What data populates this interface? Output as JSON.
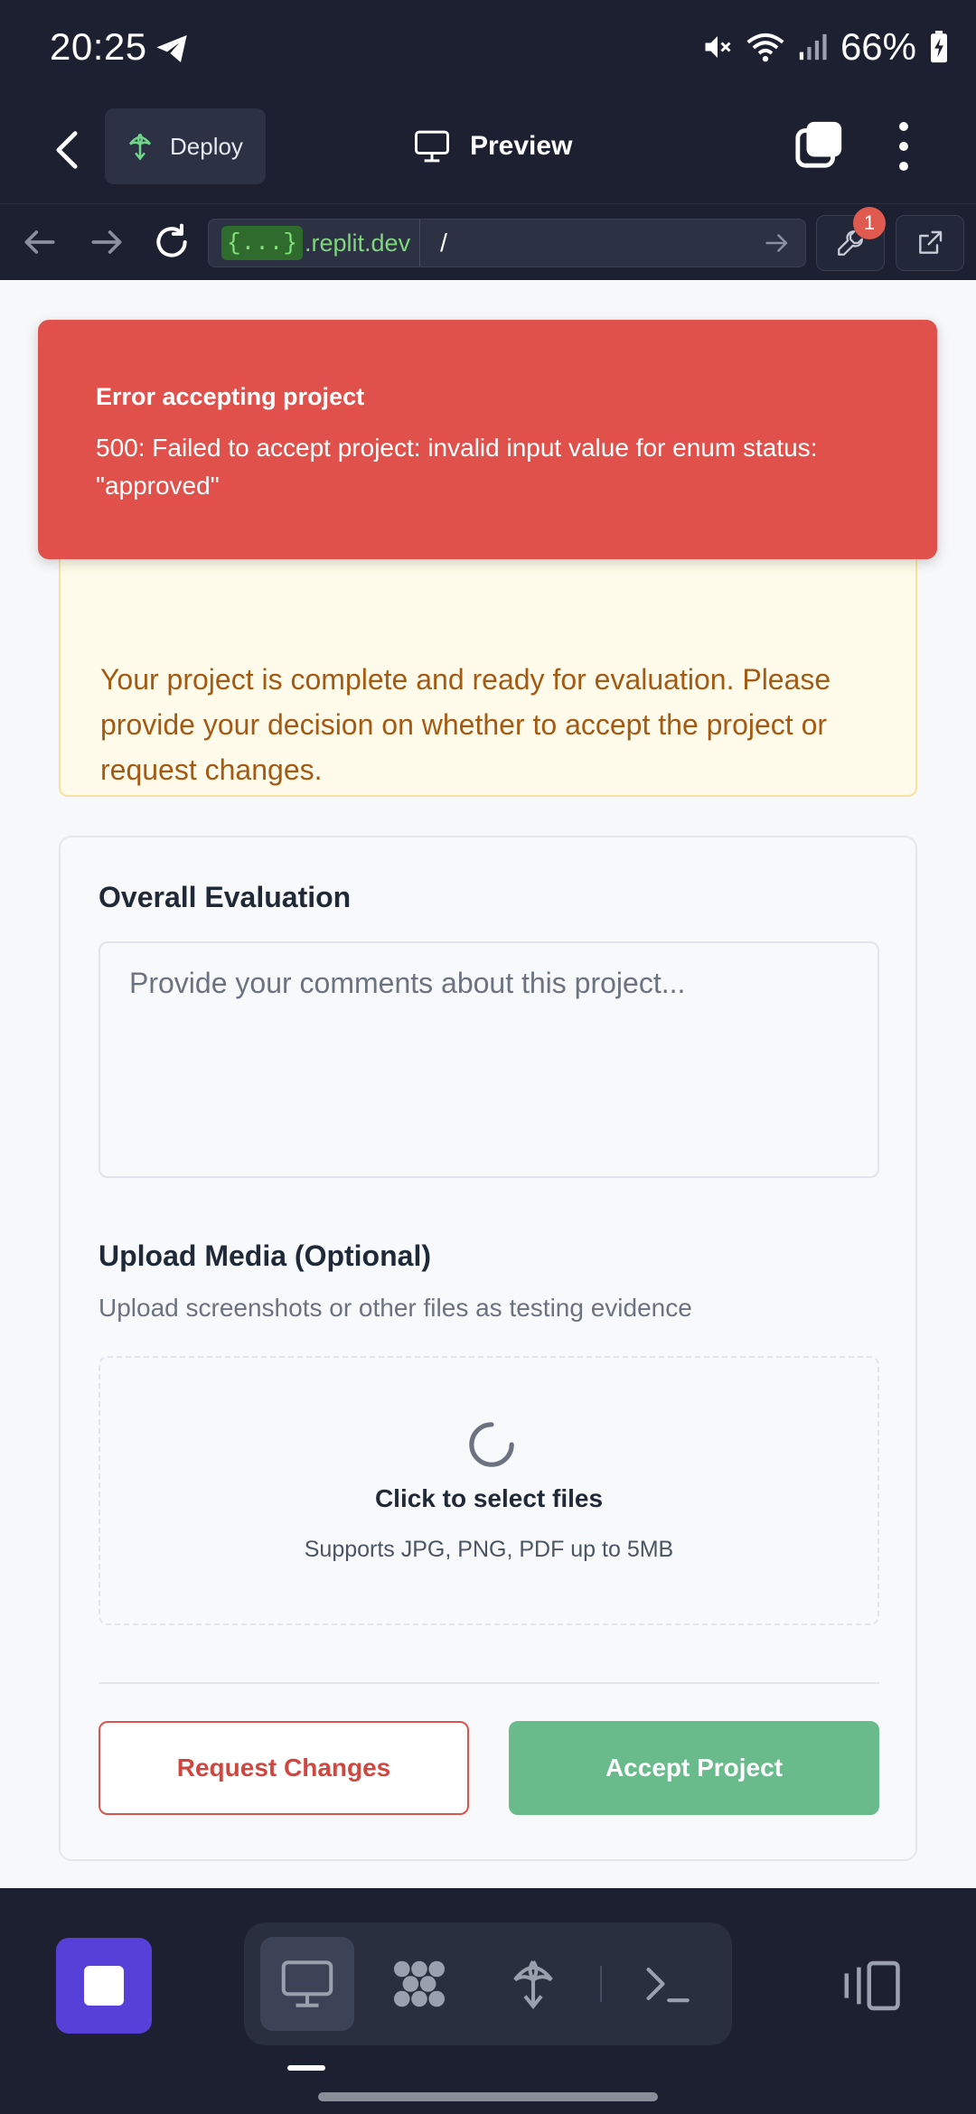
{
  "status_bar": {
    "time": "20:25",
    "battery": "66%",
    "icons": [
      "telegram-icon",
      "mute-icon",
      "wifi-icon",
      "signal-icon",
      "battery-charging-icon"
    ]
  },
  "app_bar": {
    "deploy_label": "Deploy",
    "preview_label": "Preview"
  },
  "url_bar": {
    "host_prefix": "{...}",
    "host_domain": ".replit.dev",
    "path": "/",
    "badge_count": "1"
  },
  "toast": {
    "title": "Error accepting project",
    "message": "500: Failed to accept project: invalid input value for enum status: \"approved\""
  },
  "notice": {
    "text": "Your project is complete and ready for evaluation. Please provide your decision on whether to accept the project or request changes."
  },
  "evaluation": {
    "title": "Overall Evaluation",
    "comment_placeholder": "Provide your comments about this project..."
  },
  "upload": {
    "title": "Upload Media (Optional)",
    "description": "Upload screenshots or other files as testing evidence",
    "dropzone_title": "Click to select files",
    "dropzone_subtitle": "Supports JPG, PNG, PDF up to 5MB"
  },
  "actions": {
    "request_changes": "Request Changes",
    "accept_project": "Accept Project"
  },
  "colors": {
    "toast_bg": "#e0514c",
    "accept_green": "#6abb8b",
    "request_red": "#d0473f",
    "stop_purple": "#5740d8",
    "notice_text": "#a55a14"
  }
}
